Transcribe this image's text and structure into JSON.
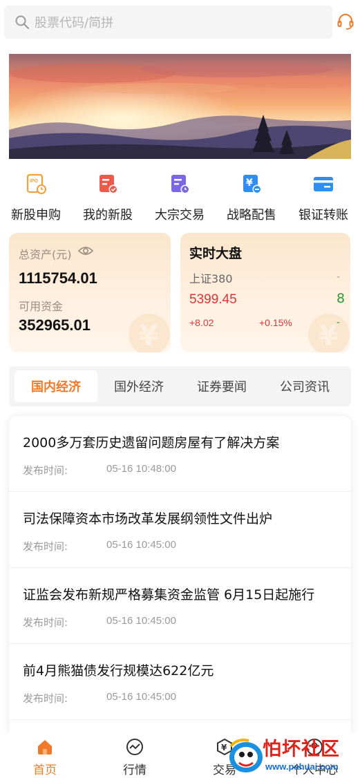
{
  "search": {
    "placeholder": "股票代码/简拼"
  },
  "quick_entries": [
    {
      "label": "新股申购",
      "icon": "ipo-clock-icon",
      "color": "#f2a03a"
    },
    {
      "label": "我的新股",
      "icon": "document-check-icon",
      "color": "#ec5a4c"
    },
    {
      "label": "大宗交易",
      "icon": "document-clock-icon",
      "color": "#7b67e6"
    },
    {
      "label": "战略配售",
      "icon": "yen-document-icon",
      "color": "#2f8ef0"
    },
    {
      "label": "银证转账",
      "icon": "card-icon",
      "color": "#2f8ef0"
    }
  ],
  "assets": {
    "total_label": "总资产(元)",
    "total_value": "1115754.01",
    "available_label": "可用资金",
    "available_value": "352965.01"
  },
  "market": {
    "title": "实时大盘",
    "index_name": "上证380",
    "price": "5399.45",
    "change": "+8.02",
    "change_pct": "+0.15%",
    "peek_name": "-",
    "peek_price": "8",
    "peek_change": "-"
  },
  "news_tabs": [
    {
      "label": "国内经济",
      "active": true
    },
    {
      "label": "国外经济",
      "active": false
    },
    {
      "label": "证券要闻",
      "active": false
    },
    {
      "label": "公司资讯",
      "active": false
    }
  ],
  "news": [
    {
      "title": "2000多万套历史遗留问题房屋有了解决方案",
      "time_label": "发布时间:",
      "time": "05-16 10:48:00"
    },
    {
      "title": "司法保障资本市场改革发展纲领性文件出炉",
      "time_label": "发布时间:",
      "time": "05-16 10:45:00"
    },
    {
      "title": "证监会发布新规严格募集资金监管 6月15日起施行",
      "time_label": "发布时间:",
      "time": "05-16 10:45:00"
    },
    {
      "title": "前4月熊猫债发行规模达622亿元",
      "time_label": "发布时间:",
      "time": "05-16 10:45:00"
    }
  ],
  "bottom_nav": [
    {
      "label": "首页",
      "icon": "home-icon",
      "active": true
    },
    {
      "label": "行情",
      "icon": "chart-circle-icon",
      "active": false
    },
    {
      "label": "交易",
      "icon": "trade-icon",
      "active": false
    },
    {
      "label": "个人中心",
      "icon": "user-icon",
      "active": false
    }
  ],
  "watermark": {
    "name": "怕坏社区",
    "url": "www.pahuai.com"
  },
  "colors": {
    "accent": "#f07a2a",
    "up": "#d93636",
    "down": "#2a9a3a"
  }
}
